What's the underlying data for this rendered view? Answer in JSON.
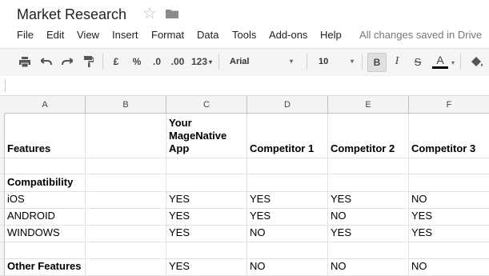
{
  "document": {
    "title": "Market Research"
  },
  "menu": {
    "items": [
      "File",
      "Edit",
      "View",
      "Insert",
      "Format",
      "Data",
      "Tools",
      "Add-ons",
      "Help"
    ],
    "save_status": "All changes saved in Drive"
  },
  "toolbar": {
    "currency": "£",
    "percent": "%",
    "decrease_decimal": ".0",
    "increase_decimal": ".00",
    "more_formats": "123",
    "font": "Arial",
    "font_size": "10",
    "bold": "B",
    "italic": "I",
    "strikethrough": "S",
    "text_color_label": "A",
    "text_color": "#000000"
  },
  "sheet": {
    "columns": [
      "A",
      "B",
      "C",
      "D",
      "E",
      "F"
    ],
    "rows": [
      [
        "Features",
        "",
        "Your\nMageNative\nApp",
        "Competitor 1",
        "Competitor 2",
        "Competitor 3"
      ],
      [
        "",
        "",
        "",
        "",
        "",
        ""
      ],
      [
        "Compatibility",
        "",
        "",
        "",
        "",
        ""
      ],
      [
        "iOS",
        "",
        "YES",
        "YES",
        "YES",
        "NO"
      ],
      [
        "ANDROID",
        "",
        "YES",
        "YES",
        "NO",
        "YES"
      ],
      [
        "WINDOWS",
        "",
        "YES",
        "NO",
        "YES",
        "YES"
      ],
      [
        "",
        "",
        "",
        "",
        "",
        ""
      ],
      [
        "Other Features",
        "",
        "YES",
        "NO",
        "NO",
        "NO"
      ]
    ]
  }
}
